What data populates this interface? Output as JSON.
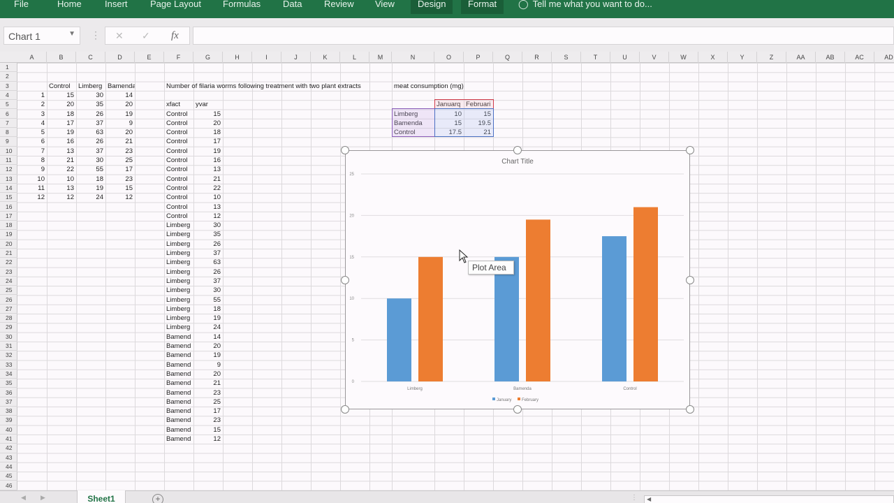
{
  "ribbon": {
    "tabs": [
      {
        "label": "File",
        "contextual": false
      },
      {
        "label": "Home",
        "contextual": false
      },
      {
        "label": "Insert",
        "contextual": false
      },
      {
        "label": "Page Layout",
        "contextual": false
      },
      {
        "label": "Formulas",
        "contextual": false
      },
      {
        "label": "Data",
        "contextual": false
      },
      {
        "label": "Review",
        "contextual": false
      },
      {
        "label": "View",
        "contextual": false
      },
      {
        "label": "Design",
        "contextual": true
      },
      {
        "label": "Format",
        "contextual": true
      }
    ],
    "tell_me": "Tell me what you want to do...",
    "accent": "#217346"
  },
  "formula_bar": {
    "name_box": "Chart 1",
    "cancel": "✕",
    "enter": "✓",
    "fx": "fx",
    "formula": ""
  },
  "columns": [
    "A",
    "B",
    "C",
    "D",
    "E",
    "F",
    "G",
    "H",
    "I",
    "J",
    "K",
    "L",
    "M",
    "N",
    "O",
    "P",
    "Q",
    "R",
    "S",
    "T",
    "U",
    "V",
    "W",
    "X",
    "Y",
    "Z",
    "AA",
    "AB",
    "AC",
    "AD"
  ],
  "row_count": 46,
  "table1": {
    "headers": [
      "Control",
      "Limberg",
      "Bamenda"
    ],
    "rows": [
      [
        1,
        15,
        30,
        14
      ],
      [
        2,
        20,
        35,
        20
      ],
      [
        3,
        18,
        26,
        19
      ],
      [
        4,
        17,
        37,
        9
      ],
      [
        5,
        19,
        63,
        20
      ],
      [
        6,
        16,
        26,
        21
      ],
      [
        7,
        13,
        37,
        23
      ],
      [
        8,
        21,
        30,
        25
      ],
      [
        9,
        22,
        55,
        17
      ],
      [
        10,
        10,
        18,
        23
      ],
      [
        11,
        13,
        19,
        15
      ],
      [
        12,
        12,
        24,
        12
      ]
    ]
  },
  "table2": {
    "title": "Number of filaria worms following treatment with two plant extracts",
    "headers": [
      "xfact",
      "yvar"
    ],
    "rows": [
      [
        "Control",
        15
      ],
      [
        "Control",
        20
      ],
      [
        "Control",
        18
      ],
      [
        "Control",
        17
      ],
      [
        "Control",
        19
      ],
      [
        "Control",
        16
      ],
      [
        "Control",
        13
      ],
      [
        "Control",
        21
      ],
      [
        "Control",
        22
      ],
      [
        "Control",
        10
      ],
      [
        "Control",
        13
      ],
      [
        "Control",
        12
      ],
      [
        "Limberg",
        30
      ],
      [
        "Limberg",
        35
      ],
      [
        "Limberg",
        26
      ],
      [
        "Limberg",
        37
      ],
      [
        "Limberg",
        63
      ],
      [
        "Limberg",
        26
      ],
      [
        "Limberg",
        37
      ],
      [
        "Limberg",
        30
      ],
      [
        "Limberg",
        55
      ],
      [
        "Limberg",
        18
      ],
      [
        "Limberg",
        19
      ],
      [
        "Limberg",
        24
      ],
      [
        "Bamend",
        14
      ],
      [
        "Bamend",
        20
      ],
      [
        "Bamend",
        19
      ],
      [
        "Bamend",
        9
      ],
      [
        "Bamend",
        20
      ],
      [
        "Bamend",
        21
      ],
      [
        "Bamend",
        23
      ],
      [
        "Bamend",
        25
      ],
      [
        "Bamend",
        17
      ],
      [
        "Bamend",
        23
      ],
      [
        "Bamend",
        15
      ],
      [
        "Bamend",
        12
      ]
    ]
  },
  "table3": {
    "title": "meat consumption (mg)",
    "headers": [
      "Januarq",
      "Februari"
    ],
    "rows": [
      [
        "Limberg",
        10,
        15
      ],
      [
        "Bamenda",
        15,
        19.5
      ],
      [
        "Control",
        17.5,
        21
      ]
    ]
  },
  "chart_data": {
    "type": "bar",
    "title": "Chart Title",
    "categories": [
      "Limberg",
      "Bamenda",
      "Control"
    ],
    "series": [
      {
        "name": "January",
        "values": [
          10,
          15,
          17.5
        ],
        "color": "#5b9bd5"
      },
      {
        "name": "February",
        "values": [
          15,
          19.5,
          21
        ],
        "color": "#ed7d31"
      }
    ],
    "xlabel": "",
    "ylabel": "",
    "ylim": [
      0,
      25
    ],
    "yticks": [
      0,
      5,
      10,
      15,
      20,
      25
    ],
    "grid": true,
    "legend": "bottom"
  },
  "tooltip": "Plot Area",
  "sheets": {
    "tabs": [
      "Sheet1"
    ],
    "add": "+"
  }
}
